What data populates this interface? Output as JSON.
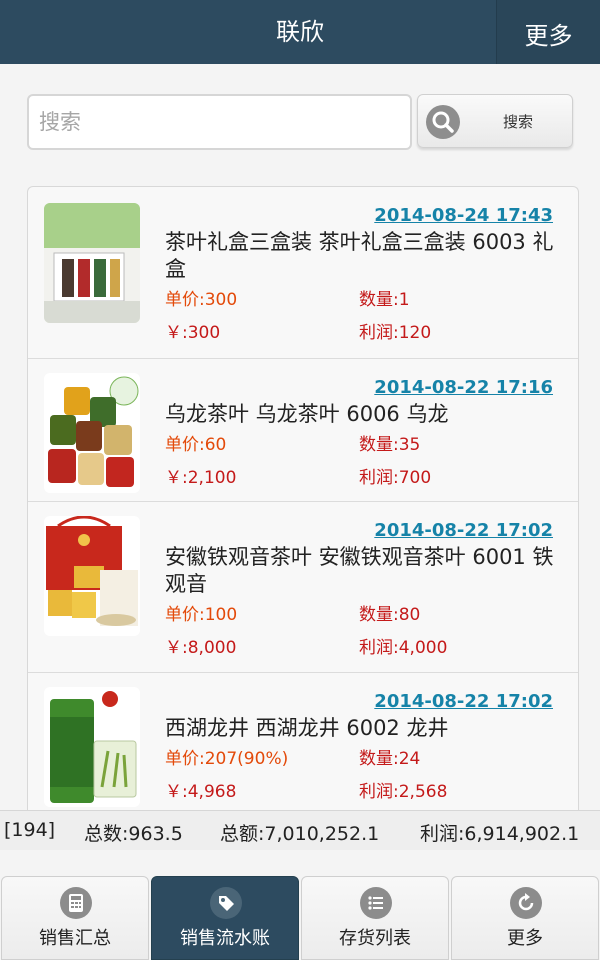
{
  "header": {
    "title": "联欣",
    "more_label": "更多"
  },
  "search": {
    "placeholder": "搜索",
    "button_label": "搜索"
  },
  "items": [
    {
      "date": "2014-08-24 17:43",
      "name": "茶叶礼盒三盒装 茶叶礼盒三盒装 6003 礼盒",
      "unit_price": "单价:300",
      "quantity": "数量:1",
      "total": "￥:300",
      "profit": "利润:120"
    },
    {
      "date": "2014-08-22 17:16",
      "name": "乌龙茶叶 乌龙茶叶 6006 乌龙",
      "unit_price": "单价:60",
      "quantity": "数量:35",
      "total": "￥:2,100",
      "profit": "利润:700"
    },
    {
      "date": "2014-08-22 17:02",
      "name": "安徽铁观音茶叶 安徽铁观音茶叶 6001 铁观音",
      "unit_price": "单价:100",
      "quantity": "数量:80",
      "total": "￥:8,000",
      "profit": "利润:4,000"
    },
    {
      "date": "2014-08-22 17:02",
      "name": "西湖龙井 西湖龙井 6002 龙井",
      "unit_price": "单价:207(90%)",
      "quantity": "数量:24",
      "total": "￥:4,968",
      "profit": "利润:2,568"
    }
  ],
  "stats": {
    "count": "[194]",
    "total_qty": "总数:963.5",
    "total_amount": "总额:7,010,252.1",
    "profit": "利润:6,914,902.1"
  },
  "tabs": [
    {
      "label": "销售汇总",
      "icon": "calculator-icon"
    },
    {
      "label": "销售流水账",
      "icon": "tag-icon"
    },
    {
      "label": "存货列表",
      "icon": "list-icon"
    },
    {
      "label": "更多",
      "icon": "refresh-icon"
    }
  ],
  "colors": {
    "header_bg": "#2d4b60",
    "date_link": "#1683a8",
    "price_orange": "#e34a0a",
    "value_red": "#c41a1a",
    "active_tab": "#2d4b60"
  }
}
